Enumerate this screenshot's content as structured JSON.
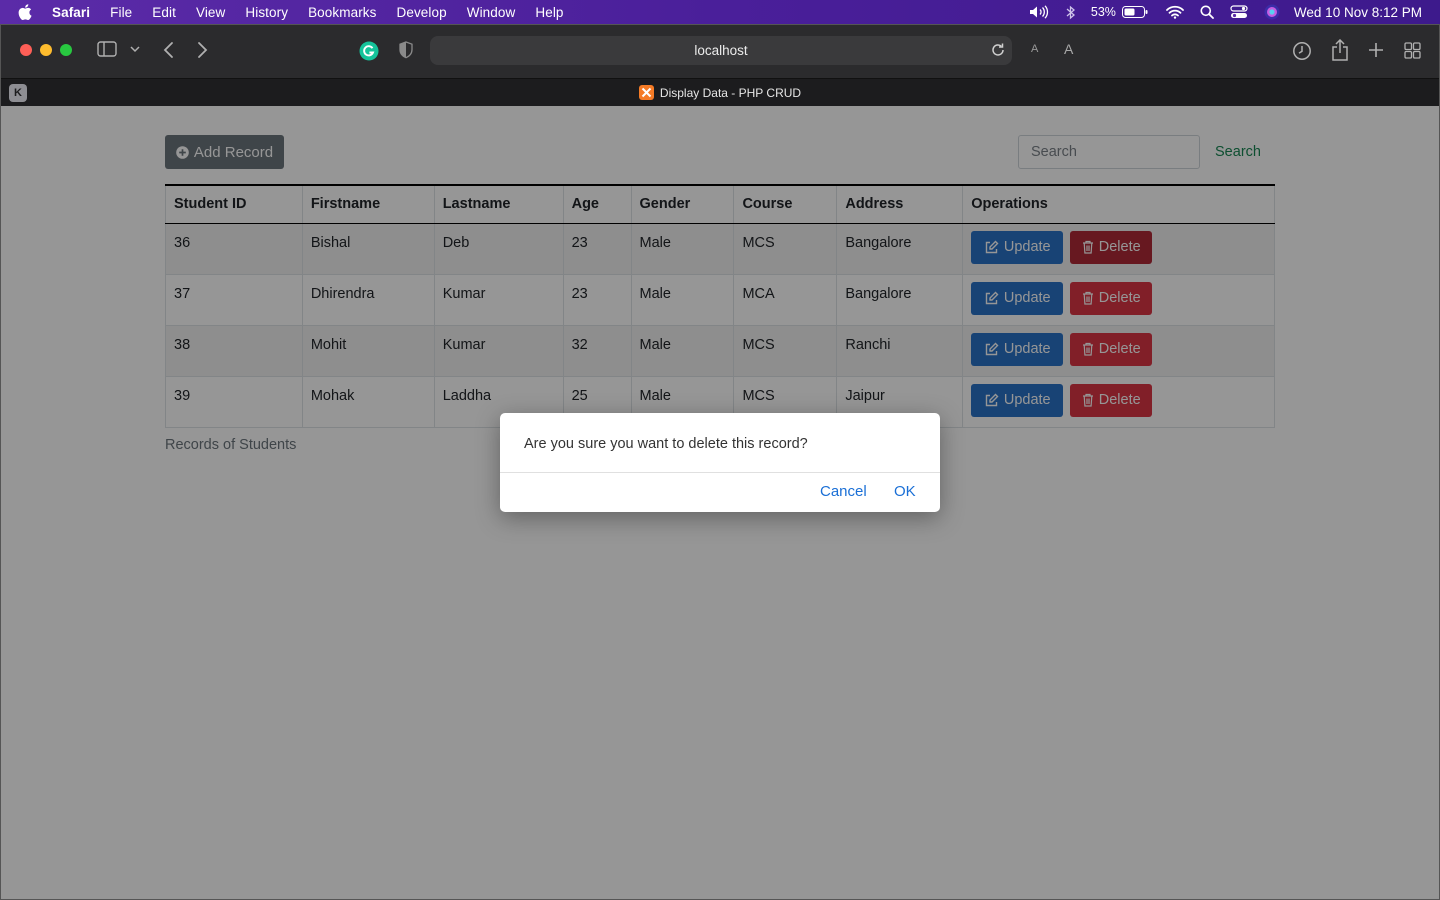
{
  "menubar": {
    "app": "Safari",
    "items": [
      "File",
      "Edit",
      "View",
      "History",
      "Bookmarks",
      "Develop",
      "Window",
      "Help"
    ],
    "battery": "53%",
    "clock": "Wed 10 Nov  8:12 PM"
  },
  "browser": {
    "address": "localhost",
    "text_small": "A",
    "text_large": "A",
    "tab_letter": "K",
    "tab_title": "Display Data - PHP CRUD"
  },
  "page": {
    "add_button": "Add Record",
    "search_placeholder": "Search",
    "search_button": "Search",
    "caption": "Records of Students",
    "columns": [
      "Student ID",
      "Firstname",
      "Lastname",
      "Age",
      "Gender",
      "Course",
      "Address",
      "Operations"
    ],
    "rows": [
      [
        "36",
        "Bishal",
        "Deb",
        "23",
        "Male",
        "MCS",
        "Bangalore"
      ],
      [
        "37",
        "Dhirendra",
        "Kumar",
        "23",
        "Male",
        "MCA",
        "Bangalore"
      ],
      [
        "38",
        "Mohit",
        "Kumar",
        "32",
        "Male",
        "MCS",
        "Ranchi"
      ],
      [
        "39",
        "Mohak",
        "Laddha",
        "25",
        "Male",
        "MCS",
        "Jaipur"
      ]
    ],
    "update_label": "Update",
    "delete_label": "Delete"
  },
  "dialog": {
    "message": "Are you sure you want to delete this record?",
    "cancel": "Cancel",
    "ok": "OK"
  }
}
